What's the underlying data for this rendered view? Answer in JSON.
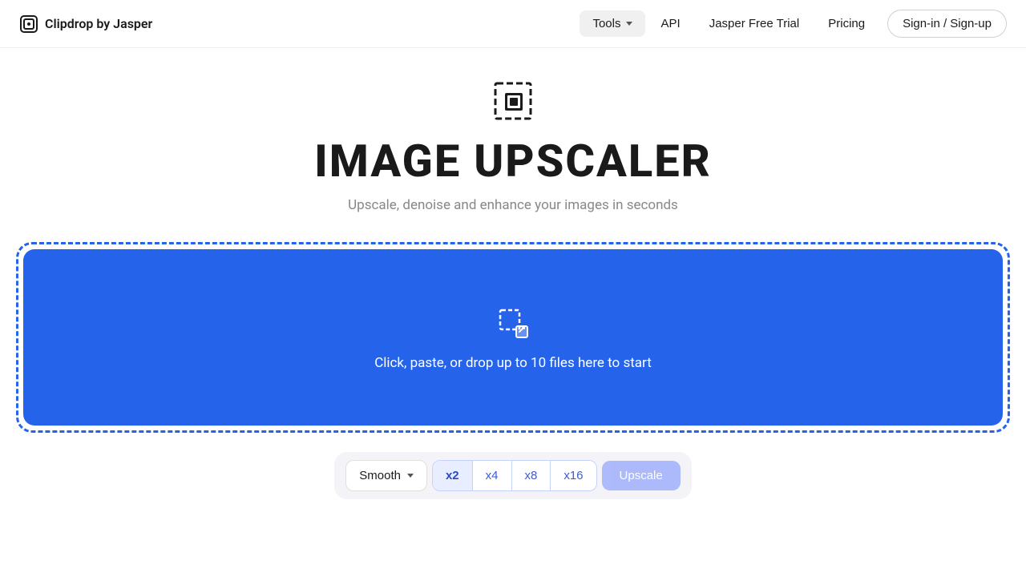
{
  "nav": {
    "logo_text": "Clipdrop by Jasper",
    "tools_label": "Tools",
    "api_label": "API",
    "trial_label": "Jasper Free Trial",
    "pricing_label": "Pricing",
    "signin_label": "Sign-in / Sign-up"
  },
  "hero": {
    "title": "IMAGE UPSCALER",
    "subtitle": "Upscale, denoise and enhance your images in seconds"
  },
  "dropzone": {
    "text": "Click, paste, or drop up to 10 files here to start"
  },
  "controls": {
    "smooth_label": "Smooth",
    "scale_options": [
      "x2",
      "x4",
      "x8",
      "x16"
    ],
    "upscale_label": "Upscale"
  }
}
